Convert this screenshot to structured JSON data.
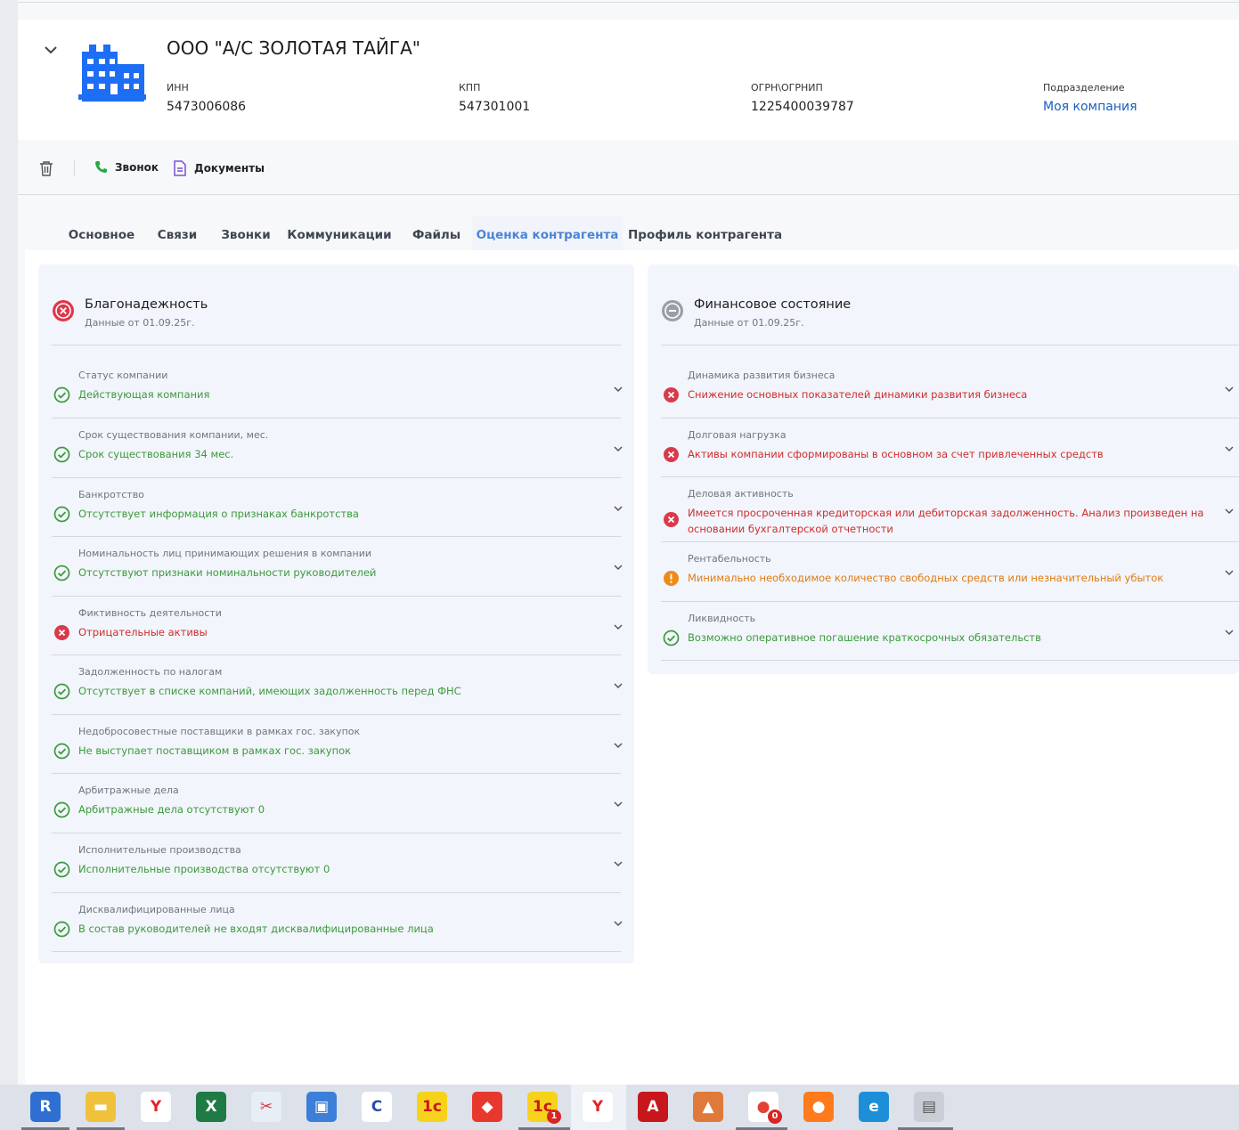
{
  "company": {
    "name": "ООО \"А/С ЗОЛОТАЯ ТАЙГА\"",
    "inn_label": "ИНН",
    "inn": "5473006086",
    "kpp_label": "КПП",
    "kpp": "547301001",
    "ogrn_label": "ОГРН\\ОГРНИП",
    "ogrn": "1225400039787",
    "dept_label": "Подразделение",
    "dept": "Моя компания"
  },
  "toolbar": {
    "call_label": "Звонок",
    "docs_label": "Документы"
  },
  "tabs": [
    {
      "label": "Основное"
    },
    {
      "label": "Связи"
    },
    {
      "label": "Звонки"
    },
    {
      "label": "Коммуникации"
    },
    {
      "label": "Файлы"
    },
    {
      "label": "Оценка контрагента",
      "active": true
    },
    {
      "label": "Профиль контрагента"
    }
  ],
  "reliability": {
    "title": "Благонадежность",
    "date": "Данные от 01.09.25г.",
    "status": "bad",
    "items": [
      {
        "label": "Статус компании",
        "value": "Действующая компания",
        "status": "ok"
      },
      {
        "label": "Срок существования компании, мес.",
        "value": "Срок существования 34 мес.",
        "status": "ok"
      },
      {
        "label": "Банкротство",
        "value": "Отсутствует информация о признаках банкротства",
        "status": "ok"
      },
      {
        "label": "Номинальность лиц принимающих решения в компании",
        "value": "Отсутствуют признаки номинальности руководителей",
        "status": "ok"
      },
      {
        "label": "Фиктивность деятельности",
        "value": "Отрицательные активы",
        "status": "bad"
      },
      {
        "label": "Задолженность по налогам",
        "value": "Отсутствует в списке компаний, имеющих задолженность перед ФНС",
        "status": "ok"
      },
      {
        "label": "Недобросовестные поставщики в рамках гос. закупок",
        "value": "Не выступает поставщиком в рамках гос. закупок",
        "status": "ok"
      },
      {
        "label": "Арбитражные дела",
        "value": "Арбитражные дела отсутствуют 0",
        "status": "ok"
      },
      {
        "label": "Исполнительные производства",
        "value": "Исполнительные производства отсутствуют 0",
        "status": "ok"
      },
      {
        "label": "Дисквалифицированные лица",
        "value": "В состав руководителей не входят дисквалифицированные лица",
        "status": "ok"
      }
    ]
  },
  "finance": {
    "title": "Финансовое состояние",
    "date": "Данные от 01.09.25г.",
    "status": "neutral",
    "items": [
      {
        "label": "Динамика развития бизнеса",
        "value": "Снижение основных показателей динамики развития бизнеса",
        "status": "bad"
      },
      {
        "label": "Долговая нагрузка",
        "value": "Активы компании сформированы в основном за счет привлеченных средств",
        "status": "bad"
      },
      {
        "label": "Деловая активность",
        "value": "Имеется просроченная кредиторская или дебиторская задолженность. Анализ произведен на",
        "value2": "основании бухгалтерской отчетности",
        "status": "bad"
      },
      {
        "label": "Рентабельность",
        "value": "Минимально необходимое количество свободных средств или незначительный убыток",
        "status": "warn"
      },
      {
        "label": "Ликвидность",
        "value": "Возможно оперативное погашение краткосрочных обязательств",
        "status": "ok"
      }
    ]
  },
  "taskbar": {
    "apps": [
      {
        "icon": "rdp-icon"
      },
      {
        "icon": "file-explorer-icon"
      },
      {
        "icon": "yandex-browser-icon"
      },
      {
        "icon": "excel-icon"
      },
      {
        "icon": "scissors-tool-icon"
      },
      {
        "icon": "network-computer-icon"
      },
      {
        "icon": "c-app-icon"
      },
      {
        "icon": "1c-icon"
      },
      {
        "icon": "anydesk-icon"
      },
      {
        "icon": "1c-notification-icon",
        "badge": "1"
      },
      {
        "icon": "yandex-browser-active-icon"
      },
      {
        "icon": "acrobat-icon"
      },
      {
        "icon": "image-viewer-icon"
      },
      {
        "icon": "chrome-icon",
        "badge": "0"
      },
      {
        "icon": "firefox-icon"
      },
      {
        "icon": "edge-icon"
      },
      {
        "icon": "printer-setup-icon"
      }
    ]
  }
}
